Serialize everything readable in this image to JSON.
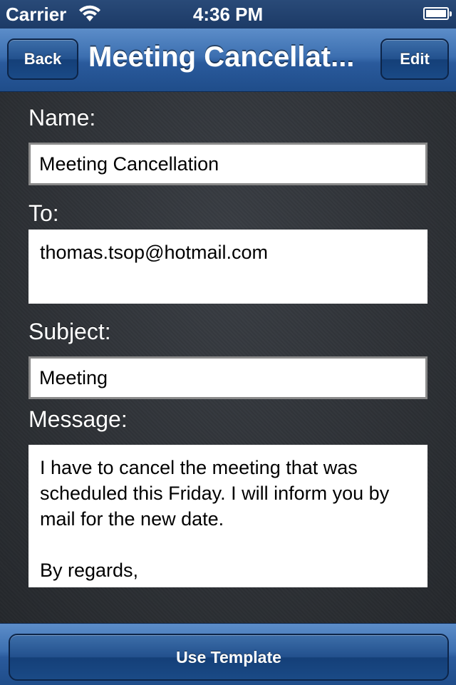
{
  "status_bar": {
    "carrier": "Carrier",
    "time": "4:36 PM",
    "wifi_icon": "wifi-icon",
    "battery_icon": "battery-icon"
  },
  "nav": {
    "title": "Meeting Cancellat...",
    "back_label": "Back",
    "edit_label": "Edit"
  },
  "form": {
    "name_label": "Name:",
    "name_value": "Meeting Cancellation",
    "to_label": "To:",
    "to_value": "thomas.tsop@hotmail.com",
    "subject_label": "Subject:",
    "subject_value": "Meeting",
    "message_label": "Message:",
    "message_value": "I have to cancel the meeting that was scheduled this Friday. I will inform you by mail for the new date.\n\nBy regards,"
  },
  "toolbar": {
    "use_template_label": "Use Template"
  },
  "colors": {
    "bar_blue": "#2a5a9c",
    "background": "#2b2e33"
  }
}
